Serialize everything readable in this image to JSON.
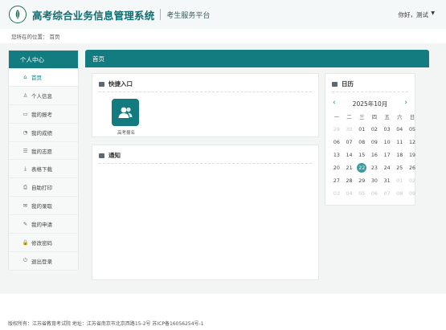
{
  "header": {
    "system_title": "高考综合业务信息管理系统",
    "platform": "考生服务平台",
    "user": "你好，测试",
    "caret": "▼"
  },
  "breadcrumb": {
    "prefix": "您所在的位置：",
    "current": "首页"
  },
  "sidebar": {
    "title": "个人中心",
    "items": [
      {
        "icon": "home-icon",
        "glyph": "⌂",
        "label": "首页"
      },
      {
        "icon": "user-icon",
        "glyph": "♙",
        "label": "个人信息"
      },
      {
        "icon": "card-icon",
        "glyph": "▭",
        "label": "我的报考"
      },
      {
        "icon": "chart-icon",
        "glyph": "◔",
        "label": "我的成绩"
      },
      {
        "icon": "list-icon",
        "glyph": "☰",
        "label": "我的志愿"
      },
      {
        "icon": "download-icon",
        "glyph": "⤓",
        "label": "表格下载"
      },
      {
        "icon": "printer-icon",
        "glyph": "⎙",
        "label": "自助打印"
      },
      {
        "icon": "mail-icon",
        "glyph": "✉",
        "label": "我的录取"
      },
      {
        "icon": "edit-icon",
        "glyph": "✎",
        "label": "我的申请"
      },
      {
        "icon": "lock-icon",
        "glyph": "🔒",
        "label": "修改密码"
      },
      {
        "icon": "power-icon",
        "glyph": "⏻",
        "label": "退出登录"
      }
    ]
  },
  "main": {
    "title": "首页",
    "quick": {
      "title": "快捷入口",
      "tile_label": "高考报名",
      "tile_icon": "users-icon"
    },
    "notice": {
      "title": "通知"
    },
    "calendar": {
      "title": "日历",
      "month": "2025年10月",
      "prev": "‹",
      "next": "›",
      "weekdays": [
        "一",
        "二",
        "三",
        "四",
        "五",
        "六",
        "日"
      ],
      "days": [
        "29",
        "30",
        "01",
        "02",
        "03",
        "04",
        "05",
        "06",
        "07",
        "08",
        "09",
        "10",
        "11",
        "12",
        "13",
        "14",
        "15",
        "16",
        "17",
        "18",
        "19",
        "20",
        "21",
        "22",
        "23",
        "24",
        "25",
        "26",
        "27",
        "28",
        "29",
        "30",
        "31",
        "01",
        "02",
        "03",
        "04",
        "05",
        "06",
        "07",
        "08",
        "09"
      ],
      "muted": [
        0,
        1,
        33,
        34,
        35,
        36,
        37,
        38,
        39,
        40,
        41
      ],
      "today_index": 23
    }
  },
  "footer": {
    "text": "版权所有：江苏省教育考试院  地址：江苏省南京市北京西路15-2号  苏ICP备16056254号-1"
  },
  "colors": {
    "primary": "#127c80",
    "today": "#3a9aa0"
  }
}
